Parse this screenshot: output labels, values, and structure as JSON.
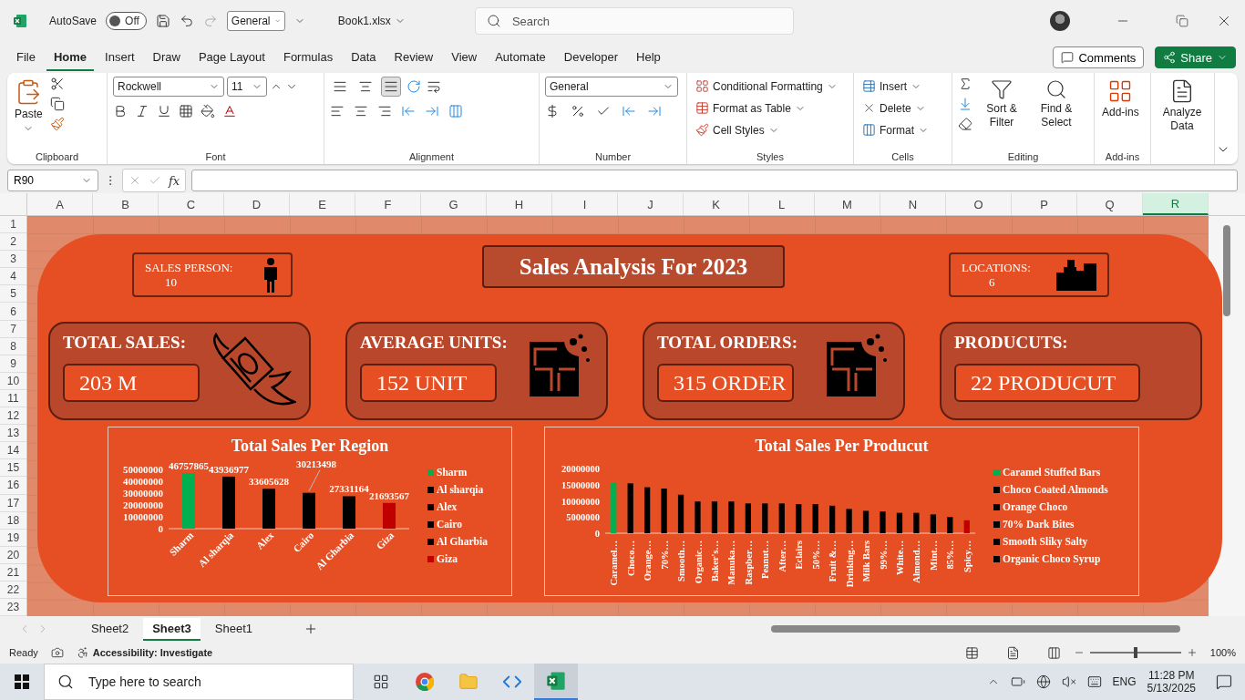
{
  "title_bar": {
    "autosave_label": "AutoSave",
    "autosave_on": false,
    "autosave_state": "Off",
    "format_box": "General",
    "file_name": "Book1.xlsx",
    "search_placeholder": "Search"
  },
  "menu_tabs": [
    {
      "label": "File",
      "selected": false
    },
    {
      "label": "Home",
      "selected": true
    },
    {
      "label": "Insert",
      "selected": false
    },
    {
      "label": "Draw",
      "selected": false
    },
    {
      "label": "Page Layout",
      "selected": false
    },
    {
      "label": "Formulas",
      "selected": false
    },
    {
      "label": "Data",
      "selected": false
    },
    {
      "label": "Review",
      "selected": false
    },
    {
      "label": "View",
      "selected": false
    },
    {
      "label": "Automate",
      "selected": false
    },
    {
      "label": "Developer",
      "selected": false
    },
    {
      "label": "Help",
      "selected": false
    }
  ],
  "comments_button": "Comments",
  "share_button": "Share",
  "ribbon": {
    "clipboard": {
      "paste": "Paste",
      "label": "Clipboard"
    },
    "font": {
      "name": "Rockwell",
      "size": "11",
      "label": "Font"
    },
    "alignment": {
      "label": "Alignment",
      "vertical_buttons": [
        {
          "kind": "top",
          "selected": false
        },
        {
          "kind": "middle",
          "selected": false
        },
        {
          "kind": "bottom",
          "selected": true
        }
      ]
    },
    "number": {
      "format": "General",
      "label": "Number"
    },
    "styles": {
      "items": [
        "Conditional Formatting",
        "Format as Table",
        "Cell Styles"
      ],
      "label": "Styles"
    },
    "cells": {
      "items": [
        "Insert",
        "Delete",
        "Format"
      ],
      "label": "Cells"
    },
    "editing": {
      "items": [
        "Sort & Filter",
        "Find & Select"
      ],
      "label": "Editing"
    },
    "addins": {
      "button": "Add-ins",
      "label": "Add-ins"
    },
    "analyze": {
      "button": "Analyze Data"
    }
  },
  "formula_bar": {
    "name_box": "R90",
    "fx": "fx"
  },
  "columns": [
    {
      "label": "A",
      "selected": false
    },
    {
      "label": "B",
      "selected": false
    },
    {
      "label": "C",
      "selected": false
    },
    {
      "label": "D",
      "selected": false
    },
    {
      "label": "E",
      "selected": false
    },
    {
      "label": "F",
      "selected": false
    },
    {
      "label": "G",
      "selected": false
    },
    {
      "label": "H",
      "selected": false
    },
    {
      "label": "I",
      "selected": false
    },
    {
      "label": "J",
      "selected": false
    },
    {
      "label": "K",
      "selected": false
    },
    {
      "label": "L",
      "selected": false
    },
    {
      "label": "M",
      "selected": false
    },
    {
      "label": "N",
      "selected": false
    },
    {
      "label": "O",
      "selected": false
    },
    {
      "label": "P",
      "selected": false
    },
    {
      "label": "Q",
      "selected": false
    },
    {
      "label": "R",
      "selected": true
    }
  ],
  "rows": [
    "1",
    "2",
    "3",
    "4",
    "5",
    "6",
    "7",
    "8",
    "9",
    "10",
    "11",
    "12",
    "13",
    "14",
    "15",
    "16",
    "17",
    "18",
    "19",
    "20",
    "21",
    "22",
    "23"
  ],
  "dashboard": {
    "title": "Sales Analysis For 2023",
    "sales_person": {
      "label": "SALES PERSON:",
      "value": "10"
    },
    "locations": {
      "label": "LOCATIONS:",
      "value": "6"
    },
    "kpis": [
      {
        "kind": "money",
        "label": "TOTAL SALES:",
        "value": "203 M"
      },
      {
        "kind": "chocolate",
        "label": "AVERAGE UNITS:",
        "value": "152 UNIT"
      },
      {
        "kind": "chocolate",
        "label": "TOTAL ORDERS:",
        "value": "315 ORDER"
      },
      {
        "kind": "plain",
        "label": "PRODUCUTS:",
        "value": "22 PRODUCUT"
      }
    ],
    "region_chart": {
      "chart_data": {
        "type": "bar",
        "title": "Total Sales Per Region",
        "categories": [
          "Sharm",
          "Al sharqia",
          "Alex",
          "Cairo",
          "Al Gharbia",
          "Giza"
        ],
        "series": [
          {
            "values": [
              46757865,
              43936977,
              33605628,
              30213498,
              27331164,
              21693567
            ]
          }
        ],
        "ylim": [
          0,
          50000000
        ],
        "yticks": [
          0,
          10000000,
          20000000,
          30000000,
          40000000,
          50000000
        ],
        "data_labels": true
      },
      "bars": [
        {
          "color": "#00b050"
        },
        {
          "color": "#000000"
        },
        {
          "color": "#000000"
        },
        {
          "color": "#000000"
        },
        {
          "color": "#000000"
        },
        {
          "color": "#c00000"
        }
      ],
      "legend": [
        {
          "label": "Sharm",
          "color": "#00b050"
        },
        {
          "label": "Al sharqia",
          "color": "#000000"
        },
        {
          "label": "Alex",
          "color": "#000000"
        },
        {
          "label": "Cairo",
          "color": "#000000"
        },
        {
          "label": "Al Gharbia",
          "color": "#000000"
        },
        {
          "label": "Giza",
          "color": "#c00000"
        }
      ]
    },
    "product_chart": {
      "chart_data": {
        "type": "bar",
        "title": "Total Sales Per Producut",
        "categories": [
          "Caramel…",
          "Choco…",
          "Orange…",
          "70%…",
          "Smooth…",
          "Organic…",
          "Baker's…",
          "Manuka…",
          "Raspber…",
          "Peanut…",
          "After…",
          "Eclairs",
          "50%…",
          "Fruit &…",
          "Drinking…",
          "Milk Bars",
          "99%…",
          "White…",
          "Almond…",
          "Mint…",
          "85%…",
          "Spicy…"
        ],
        "series": [
          {
            "values": [
              15500000,
              15400000,
              14200000,
              13800000,
              11900000,
              9800000,
              9800000,
              9800000,
              9200000,
              9200000,
              9200000,
              9000000,
              9000000,
              8500000,
              7500000,
              6900000,
              6700000,
              6300000,
              6300000,
              5800000,
              5000000,
              4000000
            ]
          }
        ],
        "ylim": [
          0,
          20000000
        ],
        "yticks": [
          0,
          5000000,
          10000000,
          15000000,
          20000000
        ]
      },
      "bars": [
        {
          "color": "#00b050"
        },
        {
          "color": "#000000"
        },
        {
          "color": "#000000"
        },
        {
          "color": "#000000"
        },
        {
          "color": "#000000"
        },
        {
          "color": "#000000"
        },
        {
          "color": "#000000"
        },
        {
          "color": "#000000"
        },
        {
          "color": "#000000"
        },
        {
          "color": "#000000"
        },
        {
          "color": "#000000"
        },
        {
          "color": "#000000"
        },
        {
          "color": "#000000"
        },
        {
          "color": "#000000"
        },
        {
          "color": "#000000"
        },
        {
          "color": "#000000"
        },
        {
          "color": "#000000"
        },
        {
          "color": "#000000"
        },
        {
          "color": "#000000"
        },
        {
          "color": "#000000"
        },
        {
          "color": "#000000"
        },
        {
          "color": "#c00000"
        }
      ],
      "legend": [
        {
          "label": "Caramel Stuffed Bars",
          "color": "#00b050"
        },
        {
          "label": "Choco Coated Almonds",
          "color": "#000000"
        },
        {
          "label": "Orange Choco",
          "color": "#000000"
        },
        {
          "label": "70% Dark Bites",
          "color": "#000000"
        },
        {
          "label": "Smooth Sliky Salty",
          "color": "#000000"
        },
        {
          "label": "Organic Choco Syrup",
          "color": "#000000"
        }
      ]
    }
  },
  "sheet_tabs": [
    {
      "label": "Sheet2",
      "selected": false
    },
    {
      "label": "Sheet3",
      "selected": true
    },
    {
      "label": "Sheet1",
      "selected": false
    }
  ],
  "status_bar": {
    "state": "Ready",
    "accessibility": "Accessibility: Investigate",
    "zoom_slider": {
      "level": 0.5
    },
    "zoom": "100%"
  },
  "taskbar": {
    "search_placeholder": "Type here to search",
    "language": "ENG",
    "time": "11:28 PM",
    "date": "5/13/2025"
  }
}
